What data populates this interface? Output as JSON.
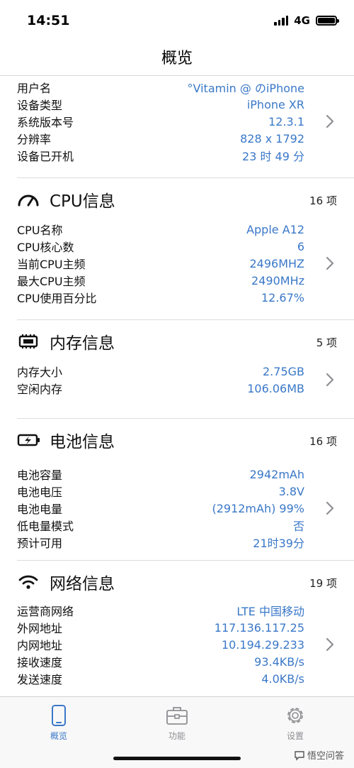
{
  "status_bar": {
    "time": "14:51",
    "network": "4G"
  },
  "nav": {
    "title": "概览"
  },
  "device": {
    "rows": [
      {
        "label": "用户名",
        "value": "°Vitamin @ のiPhone"
      },
      {
        "label": "设备类型",
        "value": "iPhone XR"
      },
      {
        "label": "系统版本号",
        "value": "12.3.1"
      },
      {
        "label": "分辨率",
        "value": "828 x 1792"
      },
      {
        "label": "设备已开机",
        "value": "23 时 49 分"
      }
    ]
  },
  "sections": [
    {
      "title": "CPU信息",
      "icon": "speedometer-icon",
      "count": "16 项",
      "rows": [
        {
          "label": "CPU名称",
          "value": "Apple A12"
        },
        {
          "label": "CPU核心数",
          "value": "6"
        },
        {
          "label": "当前CPU主频",
          "value": "2496MHZ"
        },
        {
          "label": "最大CPU主频",
          "value": "2490MHz"
        },
        {
          "label": "CPU使用百分比",
          "value": "12.67%"
        }
      ]
    },
    {
      "title": "内存信息",
      "icon": "memory-chip-icon",
      "count": "5 项",
      "rows": [
        {
          "label": "内存大小",
          "value": "2.75GB"
        },
        {
          "label": "空闲内存",
          "value": "106.06MB"
        }
      ]
    },
    {
      "title": "电池信息",
      "icon": "battery-charging-icon",
      "count": "16 项",
      "rows": [
        {
          "label": "电池容量",
          "value": "2942mAh"
        },
        {
          "label": "电池电压",
          "value": "3.8V"
        },
        {
          "label": "电池电量",
          "value": "(2912mAh) 99%"
        },
        {
          "label": "低电量模式",
          "value": "否"
        },
        {
          "label": "预计可用",
          "value": "21时39分"
        }
      ]
    },
    {
      "title": "网络信息",
      "icon": "wifi-icon",
      "count": "19 项",
      "rows": [
        {
          "label": "运营商网络",
          "value": "LTE 中国移动"
        },
        {
          "label": "外网地址",
          "value": "117.136.117.25"
        },
        {
          "label": "内网地址",
          "value": "10.194.29.233"
        },
        {
          "label": "接收速度",
          "value": "93.4KB/s"
        },
        {
          "label": "发送速度",
          "value": "4.0KB/s"
        }
      ]
    }
  ],
  "tabs": [
    {
      "label": "概览",
      "icon": "phone-icon",
      "active": true
    },
    {
      "label": "功能",
      "icon": "toolbox-icon",
      "active": false
    },
    {
      "label": "设置",
      "icon": "gear-icon",
      "active": false
    }
  ],
  "watermark": {
    "text": "悟空问答"
  },
  "colors": {
    "accent": "#3a78c8",
    "label": "#111111",
    "tab_inactive": "#8e8e93",
    "tab_active": "#3a78c8"
  }
}
